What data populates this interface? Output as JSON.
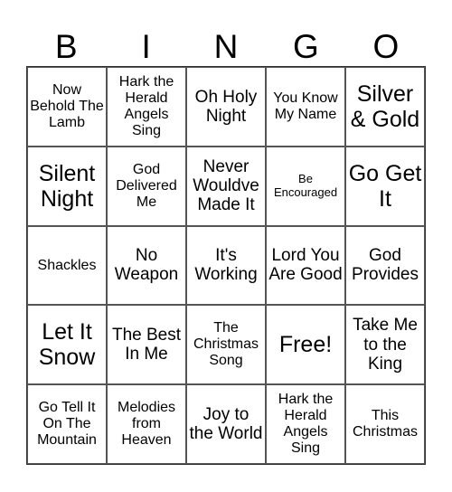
{
  "header": {
    "letters": [
      "B",
      "I",
      "N",
      "G",
      "O"
    ]
  },
  "cells": [
    {
      "text": "Now Behold The Lamb",
      "size": "s-m"
    },
    {
      "text": "Hark the Herald Angels Sing",
      "size": "s-m"
    },
    {
      "text": "Oh Holy Night",
      "size": "s-l"
    },
    {
      "text": "You Know My Name",
      "size": "s-m"
    },
    {
      "text": "Silver & Gold",
      "size": "s-xl"
    },
    {
      "text": "Silent Night",
      "size": "s-xl"
    },
    {
      "text": "God Delivered Me",
      "size": "s-m"
    },
    {
      "text": "Never Wouldve Made It",
      "size": "s-l"
    },
    {
      "text": "Be Encouraged",
      "size": "s-s"
    },
    {
      "text": "Go Get It",
      "size": "s-xl"
    },
    {
      "text": "Shackles",
      "size": "s-m"
    },
    {
      "text": "No Weapon",
      "size": "s-l"
    },
    {
      "text": "It's Working",
      "size": "s-l"
    },
    {
      "text": "Lord You Are Good",
      "size": "s-l"
    },
    {
      "text": "God Provides",
      "size": "s-l"
    },
    {
      "text": "Let It Snow",
      "size": "s-xl"
    },
    {
      "text": "The Best In Me",
      "size": "s-l"
    },
    {
      "text": "The Christmas Song",
      "size": "s-m"
    },
    {
      "text": "Free!",
      "size": "s-xl"
    },
    {
      "text": "Take Me to the King",
      "size": "s-l"
    },
    {
      "text": "Go Tell It On The Mountain",
      "size": "s-m"
    },
    {
      "text": "Melodies from Heaven",
      "size": "s-m"
    },
    {
      "text": "Joy to the World",
      "size": "s-l"
    },
    {
      "text": "Hark the Herald Angels Sing",
      "size": "s-m"
    },
    {
      "text": "This Christmas",
      "size": "s-m"
    }
  ]
}
